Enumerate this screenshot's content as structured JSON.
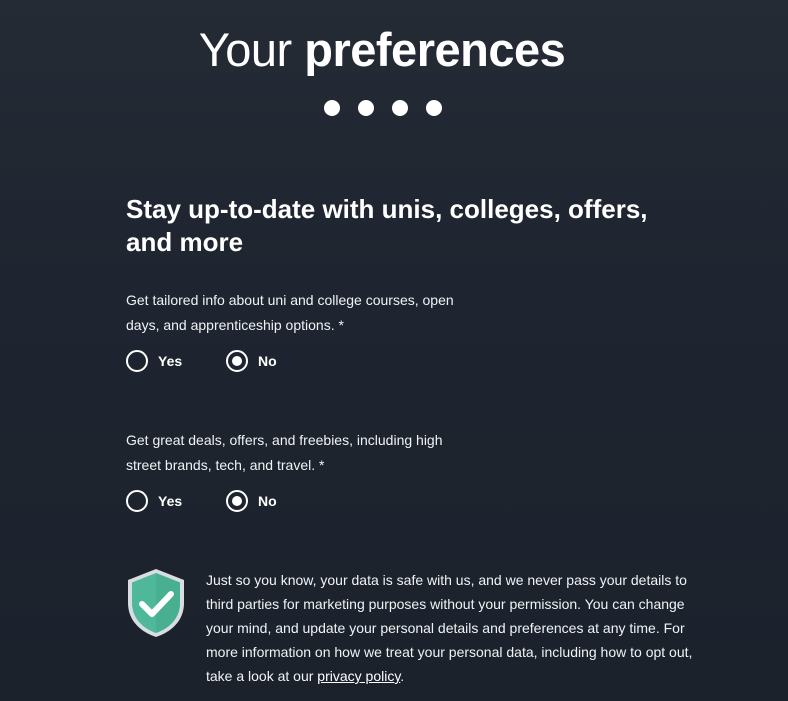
{
  "header": {
    "title_light": "Your",
    "title_bold": "preferences",
    "step_count": 4
  },
  "section": {
    "heading": "Stay up-to-date with unis, colleges, offers, and more"
  },
  "questions": [
    {
      "text": "Get tailored info about uni and college courses, open days, and apprenticeship options. *",
      "options": [
        {
          "label": "Yes",
          "selected": false
        },
        {
          "label": "No",
          "selected": true
        }
      ]
    },
    {
      "text": "Get great deals, offers, and freebies, including high street brands, tech, and travel. *",
      "options": [
        {
          "label": "Yes",
          "selected": false
        },
        {
          "label": "No",
          "selected": true
        }
      ]
    }
  ],
  "privacy": {
    "icon": "shield-check-icon",
    "text_before": "Just so you know, your data is safe with us, and we never pass your details to third parties for marketing purposes without your permission. You can change your mind, and update your personal details and preferences at any time. For more information on how we treat your personal data, including how to opt out, take a look at our ",
    "link_text": "privacy policy",
    "text_after": "."
  },
  "colors": {
    "background": "#1f2530",
    "text": "#ffffff",
    "shield_fill": "#4fb89a",
    "shield_border": "#d8dde2"
  }
}
